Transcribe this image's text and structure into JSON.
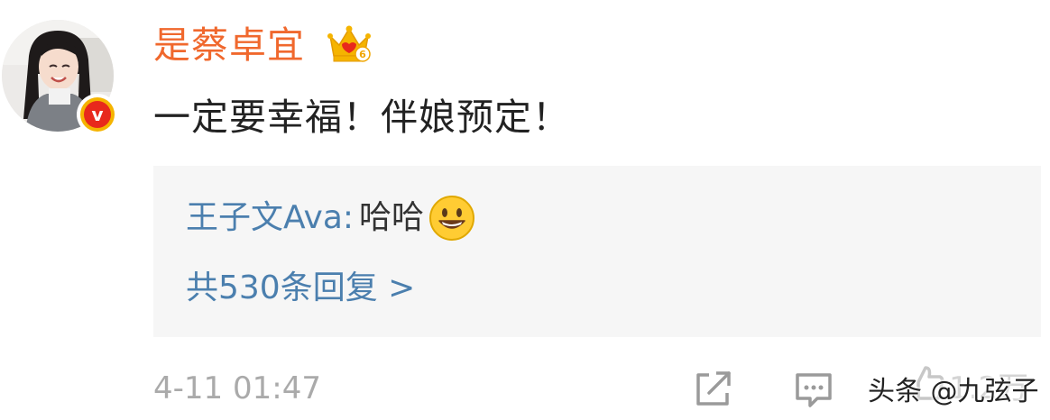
{
  "comment": {
    "author": "是蔡卓宜",
    "member_level": "6",
    "text": "一定要幸福！伴娘预定！",
    "timestamp": "4-11 01:47"
  },
  "reply_preview": {
    "author": "王子文Ava",
    "separator": ":",
    "content": "哈哈",
    "emoji": "smile-emoji",
    "view_all": "共530条回复 >"
  },
  "actions": {
    "like_count": "1.2万"
  },
  "watermark": "头条 @九弦子",
  "colors": {
    "username": "#f0682d",
    "reply_author": "#4b7fae",
    "reply_bg": "#f6f6f6",
    "meta": "#aaaaaa",
    "verified_badge": "#e8281c",
    "badge_ring": "#f5b400"
  },
  "icons": {
    "crown": "crown-icon",
    "verified": "verified-badge-icon",
    "share": "share-icon",
    "comment": "comment-icon",
    "like": "like-icon"
  }
}
